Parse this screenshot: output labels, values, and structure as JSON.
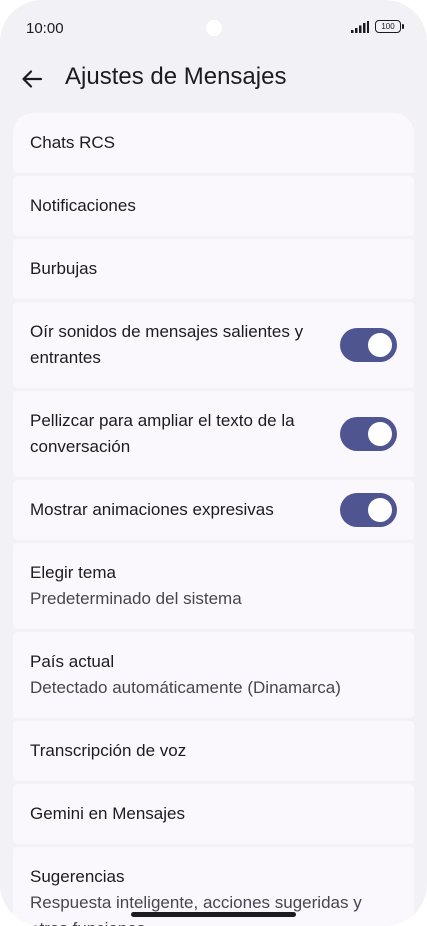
{
  "status_bar": {
    "time": "10:00",
    "battery": "100",
    "signal_icon": "signal-bars-icon"
  },
  "app_bar": {
    "back_icon": "back-arrow-icon",
    "title": "Ajustes de Mensajes"
  },
  "settings": [
    {
      "title": "Chats RCS"
    },
    {
      "title": "Notificaciones"
    },
    {
      "title": "Burbujas"
    },
    {
      "title": "Oír sonidos de mensajes salientes y entrantes",
      "toggle": true
    },
    {
      "title": "Pellizcar para ampliar el texto de la conversación",
      "toggle": true
    },
    {
      "title": "Mostrar animaciones expresivas",
      "toggle": true
    },
    {
      "title": "Elegir tema",
      "subtitle": "Predeterminado del sistema"
    },
    {
      "title": "País actual",
      "subtitle": "Detectado automáticamente (Dinamarca)"
    },
    {
      "title": "Transcripción de voz"
    },
    {
      "title": "Gemini en Mensajes"
    },
    {
      "title": "Sugerencias",
      "subtitle": "Respuesta inteligente, acciones sugeridas y otras funciones"
    }
  ],
  "colors": {
    "background": "#f2f1f6",
    "card": "#faf8fd",
    "toggle_on": "#4f5591"
  }
}
